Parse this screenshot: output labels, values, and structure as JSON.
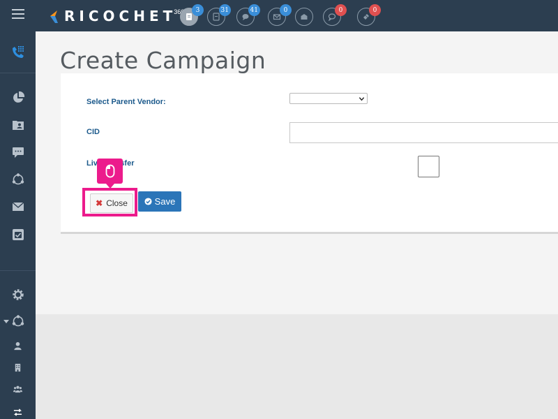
{
  "app": {
    "logo_text": "RICOCHET",
    "logo_sup": "360"
  },
  "topbar": {
    "notifications": [
      {
        "icon": "document-icon",
        "count": "3",
        "color": "blue"
      },
      {
        "icon": "file-icon",
        "count": "31",
        "color": "blue"
      },
      {
        "icon": "chat-icon",
        "count": "41",
        "color": "blue"
      },
      {
        "icon": "envelope-icon",
        "count": "0",
        "color": "blue"
      },
      {
        "icon": "envelope-open-icon",
        "count": "",
        "color": ""
      },
      {
        "icon": "comment-icon",
        "count": "0",
        "color": "red"
      },
      {
        "icon": "ticket-icon",
        "count": "0",
        "color": "red"
      }
    ]
  },
  "sidebar": {
    "items": [
      "phone-grid-icon",
      "pie-chart-icon",
      "contacts-icon",
      "message-icon",
      "network-icon",
      "mail-icon",
      "checklist-icon",
      "gear-icon",
      "network-icon",
      "user-icon",
      "building-icon",
      "users-icon",
      "transfer-icon"
    ]
  },
  "page": {
    "title": "Create Campaign"
  },
  "form": {
    "parent_vendor_label": "Select Parent Vendor:",
    "parent_vendor_value": "",
    "cid_label": "CID",
    "cid_value": "",
    "live_transfer_label": "Live Transfer",
    "live_transfer_checked": false
  },
  "buttons": {
    "close_label": "Close",
    "save_label": "Save"
  },
  "colors": {
    "nav_bg": "#2c3e50",
    "badge_blue": "#3a8ed8",
    "badge_red": "#e05050",
    "save_blue": "#2b75b8",
    "highlight": "#ec1b8c",
    "label_blue": "#1c5a8c"
  }
}
